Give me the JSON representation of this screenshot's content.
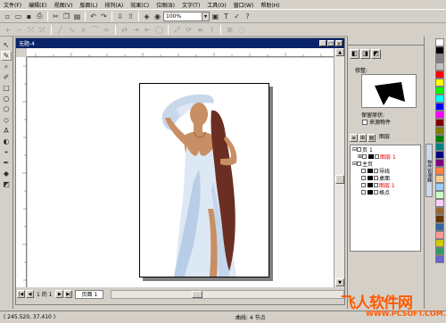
{
  "menu": [
    "文件(F)",
    "编辑(E)",
    "视图(V)",
    "版面(L)",
    "排列(A)",
    "效果(C)",
    "位图(B)",
    "文字(T)",
    "工具(O)",
    "窗口(W)",
    "帮助(H)"
  ],
  "toolbar": {
    "zoom_value": "100%"
  },
  "document": {
    "title": "无题-4",
    "page_tab": "页面 1",
    "page_count": "1 的 1"
  },
  "statusbar": {
    "coords": "( 245.520, 37.410 )",
    "curve_info": "曲线: 4 节点"
  },
  "docker": {
    "preview_label": "修整:",
    "keep_label": "保留原状:",
    "source_label": "来源物件",
    "target_label": "目标物件",
    "layer_tabs_label": "图层",
    "side_tab": "物件管理器"
  },
  "layers": [
    {
      "label": "页 1",
      "indent": 0,
      "red": false
    },
    {
      "label": "图层 1",
      "indent": 1,
      "red": true
    },
    {
      "label": "主页",
      "indent": 0,
      "red": false
    },
    {
      "label": "导线",
      "indent": 1,
      "red": false
    },
    {
      "label": "桌面",
      "indent": 1,
      "red": false
    },
    {
      "label": "图层 1",
      "indent": 1,
      "red": true
    },
    {
      "label": "格点",
      "indent": 1,
      "red": false
    }
  ],
  "watermark": {
    "title": "飞人软件网",
    "url": "WWW.PCSOFT.COM.CN"
  },
  "colors": {
    "skin": "#c98f64",
    "hair": "#6b2e22",
    "dress": "#dce8f4",
    "dress_shadow": "#b8cde6",
    "scarf": "#c8d7ea",
    "title_bar": "#0a246a"
  },
  "palette": [
    "#ffffff",
    "#000000",
    "#808080",
    "#c0c0c0",
    "#ff0000",
    "#ffff00",
    "#00ff00",
    "#00ffff",
    "#0000ff",
    "#ff00ff",
    "#800000",
    "#808000",
    "#008000",
    "#008080",
    "#000080",
    "#800080",
    "#ff8040",
    "#ffcc99",
    "#99ccff",
    "#ccffcc",
    "#ffccff",
    "#996633",
    "#663300",
    "#336699",
    "#ff9999",
    "#cccc00",
    "#339966",
    "#6666cc"
  ]
}
